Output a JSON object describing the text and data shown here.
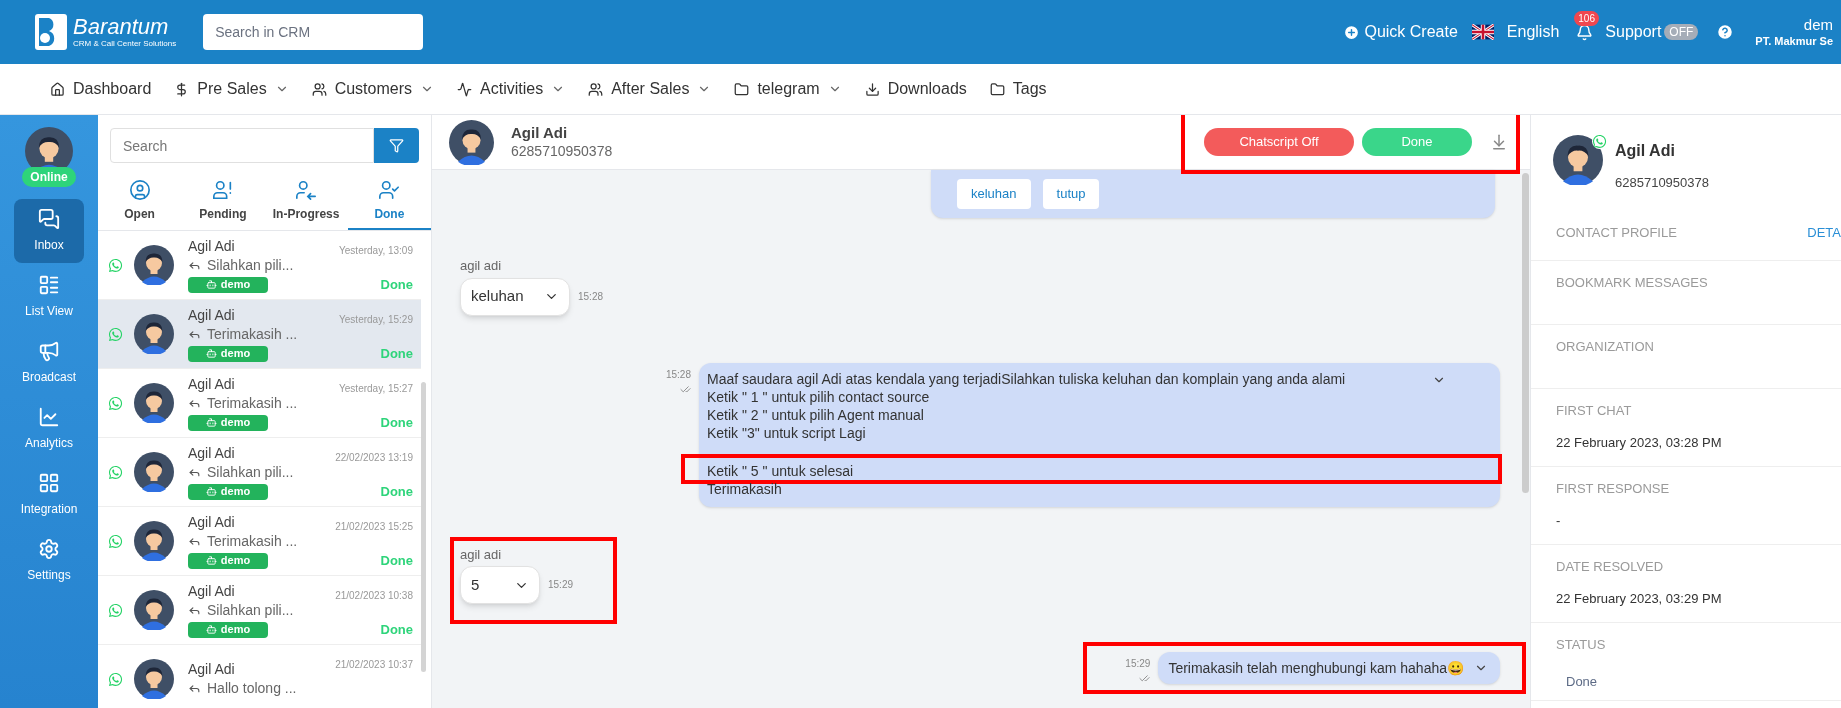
{
  "header": {
    "logo": {
      "name": "Barantum",
      "tagline": "CRM & Call Center Solutions"
    },
    "search": {
      "placeholder": "Search in CRM"
    },
    "quick_create": "Quick Create",
    "language": "English",
    "notifications": {
      "count": "106"
    },
    "support": {
      "label": "Support",
      "toggle": "OFF",
      "on": false
    },
    "user": {
      "name": "dem",
      "company": "PT. Makmur Se"
    }
  },
  "nav": [
    {
      "label": "Dashboard",
      "dropdown": false
    },
    {
      "label": "Pre Sales",
      "dropdown": true
    },
    {
      "label": "Customers",
      "dropdown": true
    },
    {
      "label": "Activities",
      "dropdown": true
    },
    {
      "label": "After Sales",
      "dropdown": true
    },
    {
      "label": "telegram",
      "dropdown": true
    },
    {
      "label": "Downloads",
      "dropdown": false
    },
    {
      "label": "Tags",
      "dropdown": false
    }
  ],
  "sidebar": {
    "status": "Online",
    "items": [
      {
        "label": "Inbox",
        "selected": true
      },
      {
        "label": "List View",
        "selected": false
      },
      {
        "label": "Broadcast",
        "selected": false
      },
      {
        "label": "Analytics",
        "selected": false
      },
      {
        "label": "Integration",
        "selected": false
      },
      {
        "label": "Settings",
        "selected": false
      }
    ]
  },
  "conversations": {
    "search": {
      "placeholder": "Search"
    },
    "tabs": [
      {
        "label": "Open",
        "kind": "open",
        "selected": false
      },
      {
        "label": "Pending",
        "kind": "pending",
        "selected": false
      },
      {
        "label": "In-Progress",
        "kind": "progress",
        "selected": false
      },
      {
        "label": "Done",
        "kind": "done",
        "selected": true
      }
    ],
    "items": [
      {
        "name": "Agil Adi",
        "preview": "Silahkan pili...",
        "tag": "demo",
        "time": "Yesterday, 13:09",
        "status": "Done",
        "selected": false
      },
      {
        "name": "Agil Adi",
        "preview": "Terimakasih ...",
        "tag": "demo",
        "time": "Yesterday, 15:29",
        "status": "Done",
        "selected": true
      },
      {
        "name": "Agil Adi",
        "preview": "Terimakasih ...",
        "tag": "demo",
        "time": "Yesterday, 15:27",
        "status": "Done",
        "selected": false
      },
      {
        "name": "Agil Adi",
        "preview": "Silahkan pili...",
        "tag": "demo",
        "time": "22/02/2023 13:19",
        "status": "Done",
        "selected": false
      },
      {
        "name": "Agil Adi",
        "preview": "Terimakasih ...",
        "tag": "demo",
        "time": "21/02/2023 15:25",
        "status": "Done",
        "selected": false
      },
      {
        "name": "Agil Adi",
        "preview": "Silahkan pili...",
        "tag": "demo",
        "time": "21/02/2023 10:38",
        "status": "Done",
        "selected": false
      },
      {
        "name": "Agil Adi",
        "preview": "Hallo tolong ...",
        "time": "21/02/2023 10:37"
      }
    ]
  },
  "chat": {
    "contact": {
      "name": "Agil Adi",
      "phone": "6285710950378"
    },
    "actions": {
      "highlighted": true,
      "chatscript": "Chatscript Off",
      "done": "Done"
    },
    "messages": [
      {
        "kind": "options",
        "options": [
          "keluhan",
          "tutup"
        ]
      },
      {
        "kind": "select",
        "sender": "agil adi",
        "value": "keluhan",
        "time": "15:28",
        "highlighted": false
      },
      {
        "kind": "text",
        "time": "15:28",
        "paragraphs": [
          [
            {
              "text": "Maaf saudara agil Adi atas kendala yang terjadiSilahkan tuliska keluhan dan komplain yang anda alami",
              "highlighted": false
            },
            {
              "text": "Ketik \" 1 \" untuk pilih contact source",
              "highlighted": false
            },
            {
              "text": "Ketik \" 2 \" untuk pilih Agent manual",
              "highlighted": false
            },
            {
              "text": "Ketik \"3\" untuk script Lagi",
              "highlighted": false
            }
          ],
          [
            {
              "text": "Ketik \" 5 \" untuk selesai",
              "highlighted": true
            },
            {
              "text": "Terimakasih",
              "highlighted": false
            }
          ]
        ],
        "highlighted": false
      },
      {
        "kind": "select",
        "sender": "agil adi",
        "value": "5",
        "time": "15:29",
        "highlighted": true
      },
      {
        "kind": "text",
        "time": "15:29",
        "paragraphs": [
          [
            {
              "text": "Terimakasih telah menghubungi kam hahaha😀",
              "highlighted": false
            }
          ]
        ],
        "highlighted": true
      }
    ]
  },
  "details": {
    "contact": {
      "name": "Agil Adi",
      "phone": "6285710950378"
    },
    "sections": [
      {
        "label": "CONTACT PROFILE",
        "link": "DETA"
      },
      {
        "label": "BOOKMARK MESSAGES"
      },
      {
        "label": "ORGANIZATION"
      },
      {
        "label": "FIRST CHAT",
        "value": "22 February 2023, 03:28 PM"
      },
      {
        "label": "FIRST RESPONSE",
        "value": "-"
      },
      {
        "label": "DATE RESOLVED",
        "value": "22 February 2023, 03:29 PM"
      },
      {
        "label": "STATUS",
        "status": "Done"
      }
    ]
  }
}
